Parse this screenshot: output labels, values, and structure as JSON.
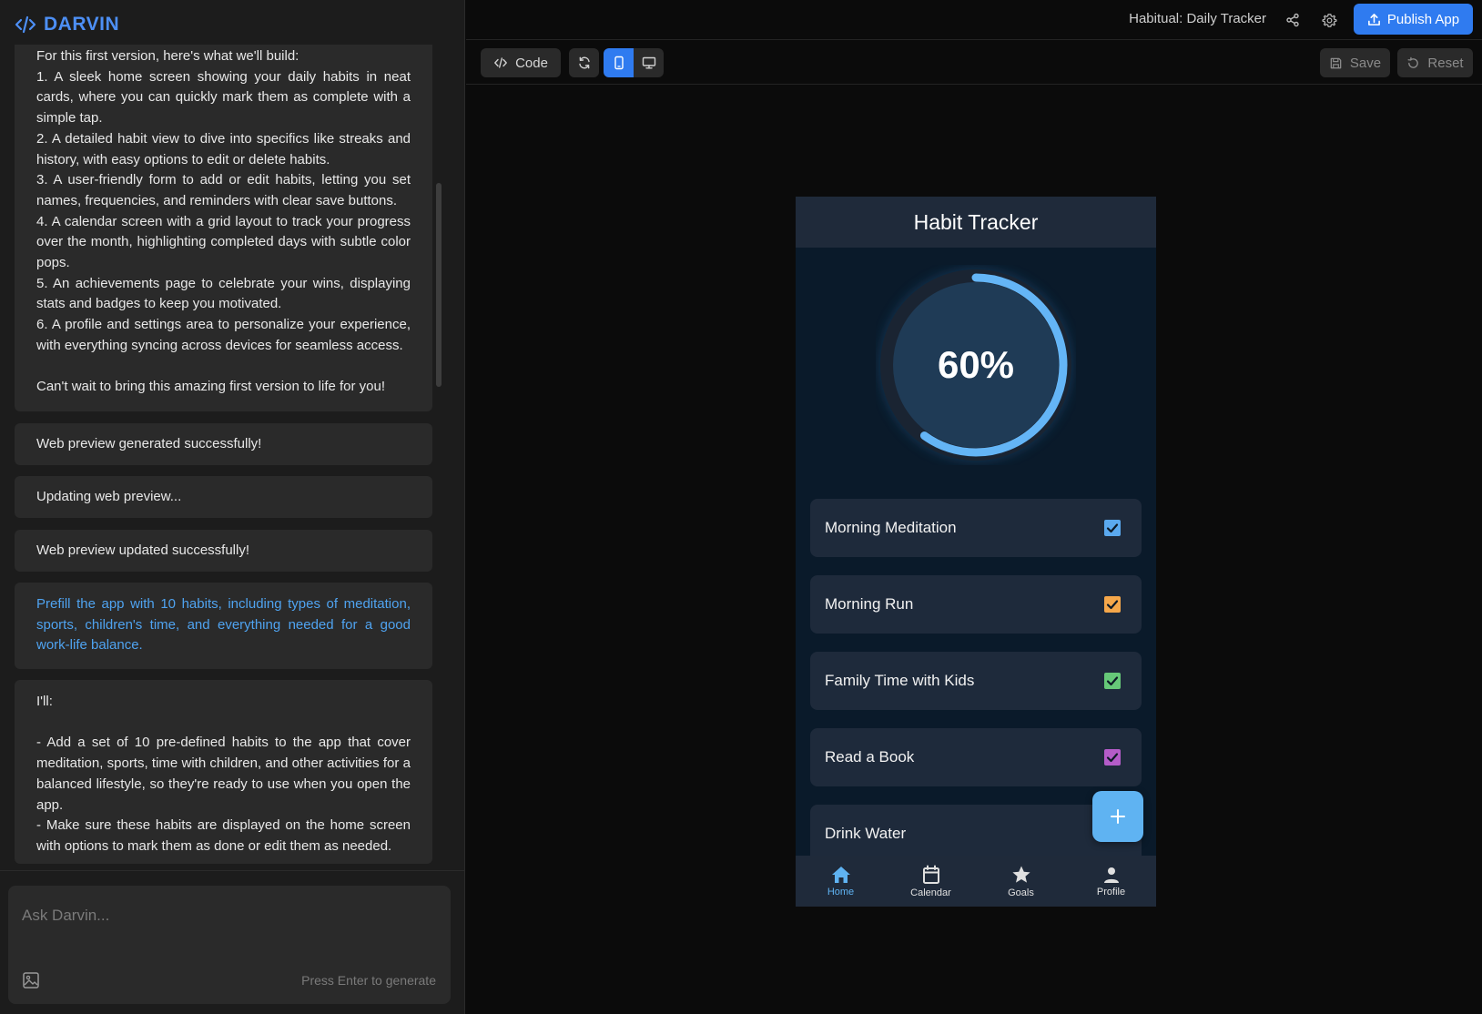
{
  "brand": {
    "name": "DARVIN"
  },
  "chat": {
    "plan_message": {
      "lines": [
        "For this first version, here's what we'll build:",
        "1. A sleek home screen showing your daily habits in neat cards, where you can quickly mark them as complete with a simple tap.",
        "2. A detailed habit view to dive into specifics like streaks and history, with easy options to edit or delete habits.",
        "3. A user-friendly form to add or edit habits, letting you set names, frequencies, and reminders with clear save buttons.",
        "4. A calendar screen with a grid layout to track your progress over the month, highlighting completed days with subtle color pops.",
        "5. An achievements page to celebrate your wins, displaying stats and badges to keep you motivated.",
        "6. A profile and settings area to personalize your experience, with everything syncing across devices for seamless access."
      ],
      "closing": "Can't wait to bring this amazing first version to life for you!"
    },
    "status_1": "Web preview generated successfully!",
    "status_2": "Updating web preview...",
    "status_3": "Web preview updated successfully!",
    "user_message": "Prefill the app with 10 habits, including types of meditation, sports, children's time, and everything needed for a good work-life balance.",
    "reply": {
      "intro": "I'll:",
      "points": [
        "- Add a set of 10 pre-defined habits to the app that cover meditation, sports, time with children, and other activities for a balanced lifestyle, so they're ready to use when you open the app.",
        "- Make sure these habits are displayed on the home screen with options to mark them as done or edit them as needed."
      ]
    }
  },
  "composer": {
    "placeholder": "Ask Darvin...",
    "hint": "Press Enter to generate"
  },
  "topbar": {
    "app_title": "Habitual: Daily Tracker",
    "publish_label": "Publish App"
  },
  "toolbar": {
    "code_label": "Code",
    "save_label": "Save",
    "reset_label": "Reset"
  },
  "preview": {
    "title": "Habit Tracker",
    "progress_label": "60%",
    "progress_fraction": 0.6,
    "ring_color": "#64b5f6",
    "habits": [
      {
        "name": "Morning Meditation",
        "checked": true,
        "color": "#5aa9ef"
      },
      {
        "name": "Morning Run",
        "checked": true,
        "color": "#f5a74a"
      },
      {
        "name": "Family Time with Kids",
        "checked": true,
        "color": "#66c878"
      },
      {
        "name": "Read a Book",
        "checked": true,
        "color": "#b45cc8"
      },
      {
        "name": "Drink Water",
        "checked": true,
        "color": "#5aa9ef"
      }
    ],
    "nav": [
      {
        "label": "Home",
        "icon": "home-icon",
        "active": true
      },
      {
        "label": "Calendar",
        "icon": "calendar-icon",
        "active": false
      },
      {
        "label": "Goals",
        "icon": "star-icon",
        "active": false
      },
      {
        "label": "Profile",
        "icon": "person-icon",
        "active": false
      }
    ]
  },
  "colors": {
    "accent": "#2f7bf0",
    "brand": "#4d8ff5",
    "user_text": "#4fa3f0",
    "fab": "#5fb3f2"
  }
}
